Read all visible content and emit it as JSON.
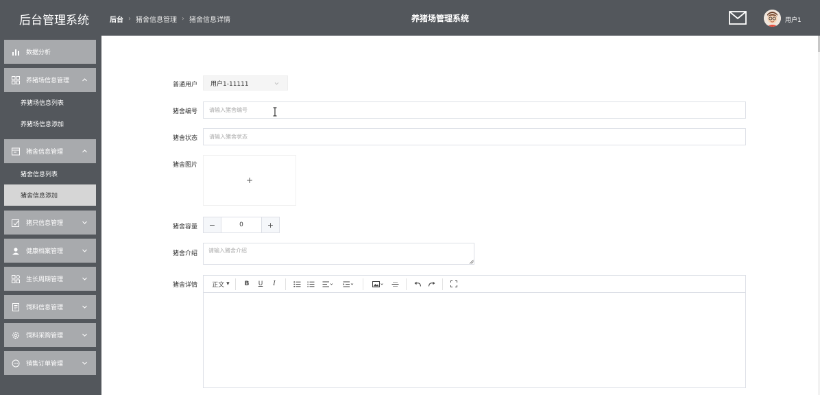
{
  "header": {
    "app_title": "后台管理系统",
    "breadcrumb": [
      "后台",
      "猪舍信息管理",
      "猪舍信息详情"
    ],
    "center_title": "养猪场管理系统",
    "user_name": "用户1"
  },
  "sidebar": {
    "groups": [
      {
        "label": "数据分析",
        "icon": "bar-chart-icon",
        "expanded": false,
        "items": []
      },
      {
        "label": "养猪场信息管理",
        "icon": "grid-icon",
        "expanded": true,
        "items": [
          {
            "label": "养猪场信息列表"
          },
          {
            "label": "养猪场信息添加"
          }
        ]
      },
      {
        "label": "猪舍信息管理",
        "icon": "window-icon",
        "expanded": true,
        "items": [
          {
            "label": "猪舍信息列表"
          },
          {
            "label": "猪舍信息添加",
            "active": true
          }
        ]
      },
      {
        "label": "猪只信息管理",
        "icon": "edit-icon",
        "expanded": false,
        "items": []
      },
      {
        "label": "健康档案管理",
        "icon": "user-icon",
        "expanded": false,
        "items": []
      },
      {
        "label": "生长周期管理",
        "icon": "apps-icon",
        "expanded": false,
        "items": []
      },
      {
        "label": "饲料信息管理",
        "icon": "document-icon",
        "expanded": false,
        "items": []
      },
      {
        "label": "饲料采购管理",
        "icon": "settings-icon",
        "expanded": false,
        "items": []
      },
      {
        "label": "销售订单管理",
        "icon": "chat-icon",
        "expanded": false,
        "items": []
      }
    ]
  },
  "form": {
    "user_label": "普通用户",
    "user_value": "用户1-11111",
    "code_label": "猪舍编号",
    "code_placeholder": "请输入猪舍编号",
    "status_label": "猪舍状态",
    "status_placeholder": "请输入猪舍状态",
    "image_label": "猪舍图片",
    "upload_symbol": "+",
    "capacity_label": "猪舍容量",
    "capacity_value": "0",
    "minus_symbol": "−",
    "plus_symbol": "+",
    "intro_label": "猪舍介绍",
    "intro_placeholder": "请输入猪舍介绍",
    "detail_label": "猪舍详情"
  },
  "editor": {
    "heading_select": "正文",
    "bold": "B",
    "underline": "U",
    "italic": "I"
  },
  "colors": {
    "header_bg": "#53575c",
    "menu_head_bg": "#a8aaad",
    "active_item_bg": "#d6d6d6"
  }
}
